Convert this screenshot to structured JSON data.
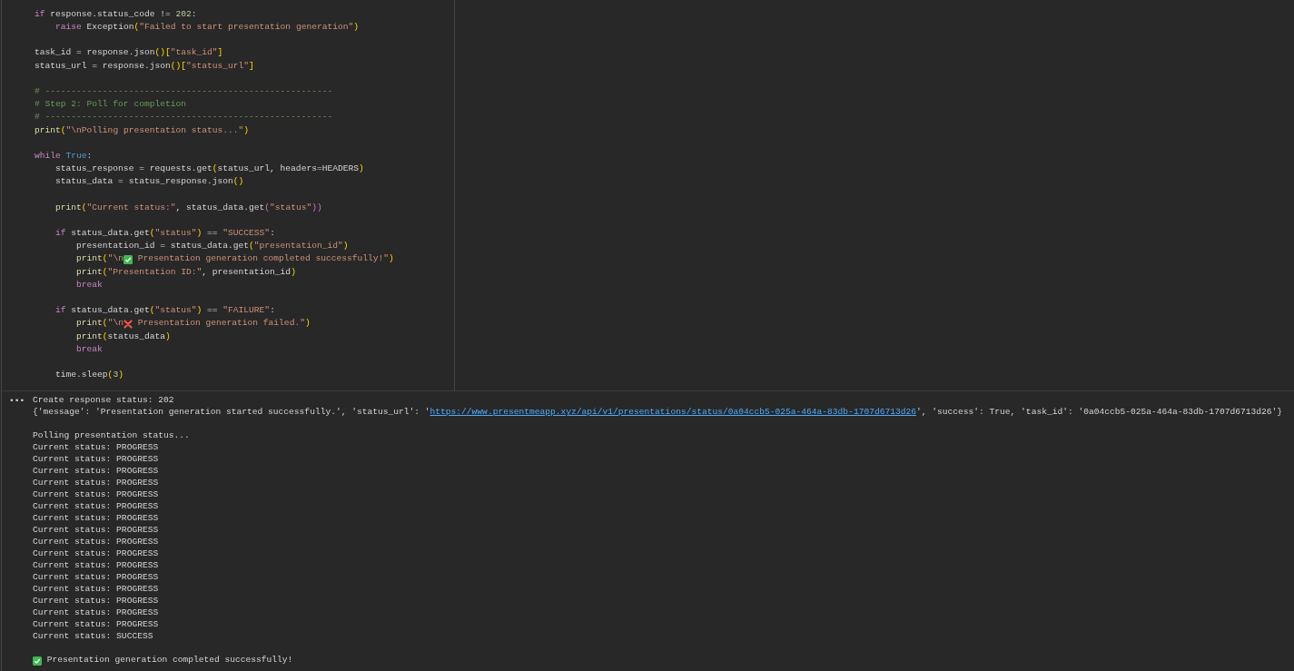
{
  "code_cell": {
    "lines": [
      {
        "tokens": [
          {
            "text": "if",
            "kind": "kw"
          },
          {
            "text": " response.status_code != ",
            "kind": "p"
          },
          {
            "text": "202",
            "kind": "num"
          },
          {
            "text": ":",
            "kind": "p"
          }
        ]
      },
      {
        "tokens": [
          {
            "text": "    raise",
            "kind": "kw"
          },
          {
            "text": " Exception",
            "kind": "p"
          },
          {
            "text": "(",
            "kind": "b1"
          },
          {
            "text": "\"Failed to start presentation generation\"",
            "kind": "str"
          },
          {
            "text": ")",
            "kind": "b1"
          }
        ]
      },
      {
        "kind": "blank"
      },
      {
        "tokens": [
          {
            "text": "task_id = response.json",
            "kind": "p"
          },
          {
            "text": "()[",
            "kind": "b1"
          },
          {
            "text": "\"task_id\"",
            "kind": "str"
          },
          {
            "text": "]",
            "kind": "b1"
          }
        ]
      },
      {
        "tokens": [
          {
            "text": "status_url = response.json",
            "kind": "p"
          },
          {
            "text": "()[",
            "kind": "b1"
          },
          {
            "text": "\"status_url\"",
            "kind": "str"
          },
          {
            "text": "]",
            "kind": "b1"
          }
        ]
      },
      {
        "kind": "blank"
      },
      {
        "tokens": [
          {
            "text": "# -------------------------------------------------------",
            "kind": "cmt"
          }
        ]
      },
      {
        "tokens": [
          {
            "text": "# Step 2: Poll for completion",
            "kind": "cmt"
          }
        ]
      },
      {
        "tokens": [
          {
            "text": "# -------------------------------------------------------",
            "kind": "cmt"
          }
        ]
      },
      {
        "tokens": [
          {
            "text": "print",
            "kind": "fn"
          },
          {
            "text": "(",
            "kind": "b1"
          },
          {
            "text": "\"\\nPolling presentation status...\"",
            "kind": "str"
          },
          {
            "text": ")",
            "kind": "b1"
          }
        ]
      },
      {
        "kind": "blank"
      },
      {
        "tokens": [
          {
            "text": "while",
            "kind": "kw"
          },
          {
            "text": " True",
            "kind": "const"
          },
          {
            "text": ":",
            "kind": "p"
          }
        ]
      },
      {
        "tokens": [
          {
            "text": "    status_response = requests.get",
            "kind": "p"
          },
          {
            "text": "(",
            "kind": "b1"
          },
          {
            "text": "status_url, headers=HEADERS",
            "kind": "p"
          },
          {
            "text": ")",
            "kind": "b1"
          }
        ]
      },
      {
        "tokens": [
          {
            "text": "    status_data = status_response.json",
            "kind": "p"
          },
          {
            "text": "()",
            "kind": "b1"
          }
        ]
      },
      {
        "kind": "blank"
      },
      {
        "tokens": [
          {
            "text": "    print",
            "kind": "fn"
          },
          {
            "text": "(",
            "kind": "b1"
          },
          {
            "text": "\"Current status:\"",
            "kind": "str"
          },
          {
            "text": ", status_data.get",
            "kind": "p"
          },
          {
            "text": "(",
            "kind": "b2"
          },
          {
            "text": "\"status\"",
            "kind": "str"
          },
          {
            "text": "))",
            "kind": "b2"
          }
        ]
      },
      {
        "kind": "blank"
      },
      {
        "tokens": [
          {
            "text": "    if",
            "kind": "kw"
          },
          {
            "text": " status_data.get",
            "kind": "p"
          },
          {
            "text": "(",
            "kind": "b1"
          },
          {
            "text": "\"status\"",
            "kind": "str"
          },
          {
            "text": ")",
            "kind": "b1"
          },
          {
            "text": " == ",
            "kind": "p"
          },
          {
            "text": "\"SUCCESS\"",
            "kind": "str"
          },
          {
            "text": ":",
            "kind": "p"
          }
        ]
      },
      {
        "tokens": [
          {
            "text": "        presentation_id = status_data.get",
            "kind": "p"
          },
          {
            "text": "(",
            "kind": "b1"
          },
          {
            "text": "\"presentation_id\"",
            "kind": "str"
          },
          {
            "text": ")",
            "kind": "b1"
          }
        ]
      },
      {
        "tokens": [
          {
            "text": "        print",
            "kind": "fn"
          },
          {
            "text": "(",
            "kind": "b1"
          },
          {
            "text": "\"\\n",
            "kind": "str"
          },
          {
            "kind": "check"
          },
          {
            "text": " Presentation generation completed successfully!\"",
            "kind": "str"
          },
          {
            "text": ")",
            "kind": "b1"
          }
        ]
      },
      {
        "tokens": [
          {
            "text": "        print",
            "kind": "fn"
          },
          {
            "text": "(",
            "kind": "b1"
          },
          {
            "text": "\"Presentation ID:\"",
            "kind": "str"
          },
          {
            "text": ", presentation_id",
            "kind": "p"
          },
          {
            "text": ")",
            "kind": "b1"
          }
        ]
      },
      {
        "tokens": [
          {
            "text": "        break",
            "kind": "kw"
          }
        ]
      },
      {
        "kind": "blank"
      },
      {
        "tokens": [
          {
            "text": "    if",
            "kind": "kw"
          },
          {
            "text": " status_data.get",
            "kind": "p"
          },
          {
            "text": "(",
            "kind": "b1"
          },
          {
            "text": "\"status\"",
            "kind": "str"
          },
          {
            "text": ")",
            "kind": "b1"
          },
          {
            "text": " == ",
            "kind": "p"
          },
          {
            "text": "\"FAILURE\"",
            "kind": "str"
          },
          {
            "text": ":",
            "kind": "p"
          }
        ]
      },
      {
        "tokens": [
          {
            "text": "        print",
            "kind": "fn"
          },
          {
            "text": "(",
            "kind": "b1"
          },
          {
            "text": "\"\\n",
            "kind": "str"
          },
          {
            "kind": "cross"
          },
          {
            "text": " Presentation generation failed.\"",
            "kind": "str"
          },
          {
            "text": ")",
            "kind": "b1"
          }
        ]
      },
      {
        "tokens": [
          {
            "text": "        print",
            "kind": "fn"
          },
          {
            "text": "(",
            "kind": "b1"
          },
          {
            "text": "status_data",
            "kind": "p"
          },
          {
            "text": ")",
            "kind": "b1"
          }
        ]
      },
      {
        "tokens": [
          {
            "text": "        break",
            "kind": "kw"
          }
        ]
      },
      {
        "kind": "blank"
      },
      {
        "tokens": [
          {
            "text": "    time.sleep",
            "kind": "p"
          },
          {
            "text": "(",
            "kind": "b1"
          },
          {
            "text": "3",
            "kind": "num"
          },
          {
            "text": ")",
            "kind": "b1"
          }
        ]
      }
    ]
  },
  "output": {
    "menu_glyph": "•••",
    "lines": [
      {
        "tokens": [
          {
            "text": "Create response status: 202",
            "kind": "p"
          }
        ]
      },
      {
        "tokens": [
          {
            "text": "{'message': 'Presentation generation started successfully.', 'status_url': '",
            "kind": "p"
          },
          {
            "text": "https://www.presentmeapp.xyz/api/v1/presentations/status/0a04ccb5-025a-464a-83db-1707d6713d26",
            "kind": "link"
          },
          {
            "text": "', 'success': True, 'task_id': '0a04ccb5-025a-464a-83db-1707d6713d26'}",
            "kind": "p"
          }
        ]
      },
      {
        "kind": "blank"
      },
      {
        "tokens": [
          {
            "text": "Polling presentation status...",
            "kind": "p"
          }
        ]
      },
      {
        "tokens": [
          {
            "text": "Current status: PROGRESS",
            "kind": "p"
          }
        ]
      },
      {
        "tokens": [
          {
            "text": "Current status: PROGRESS",
            "kind": "p"
          }
        ]
      },
      {
        "tokens": [
          {
            "text": "Current status: PROGRESS",
            "kind": "p"
          }
        ]
      },
      {
        "tokens": [
          {
            "text": "Current status: PROGRESS",
            "kind": "p"
          }
        ]
      },
      {
        "tokens": [
          {
            "text": "Current status: PROGRESS",
            "kind": "p"
          }
        ]
      },
      {
        "tokens": [
          {
            "text": "Current status: PROGRESS",
            "kind": "p"
          }
        ]
      },
      {
        "tokens": [
          {
            "text": "Current status: PROGRESS",
            "kind": "p"
          }
        ]
      },
      {
        "tokens": [
          {
            "text": "Current status: PROGRESS",
            "kind": "p"
          }
        ]
      },
      {
        "tokens": [
          {
            "text": "Current status: PROGRESS",
            "kind": "p"
          }
        ]
      },
      {
        "tokens": [
          {
            "text": "Current status: PROGRESS",
            "kind": "p"
          }
        ]
      },
      {
        "tokens": [
          {
            "text": "Current status: PROGRESS",
            "kind": "p"
          }
        ]
      },
      {
        "tokens": [
          {
            "text": "Current status: PROGRESS",
            "kind": "p"
          }
        ]
      },
      {
        "tokens": [
          {
            "text": "Current status: PROGRESS",
            "kind": "p"
          }
        ]
      },
      {
        "tokens": [
          {
            "text": "Current status: PROGRESS",
            "kind": "p"
          }
        ]
      },
      {
        "tokens": [
          {
            "text": "Current status: PROGRESS",
            "kind": "p"
          }
        ]
      },
      {
        "tokens": [
          {
            "text": "Current status: PROGRESS",
            "kind": "p"
          }
        ]
      },
      {
        "tokens": [
          {
            "text": "Current status: SUCCESS",
            "kind": "p"
          }
        ]
      },
      {
        "kind": "blank"
      },
      {
        "tokens": [
          {
            "kind": "check"
          },
          {
            "text": " Presentation generation completed successfully!",
            "kind": "p"
          }
        ]
      }
    ]
  }
}
